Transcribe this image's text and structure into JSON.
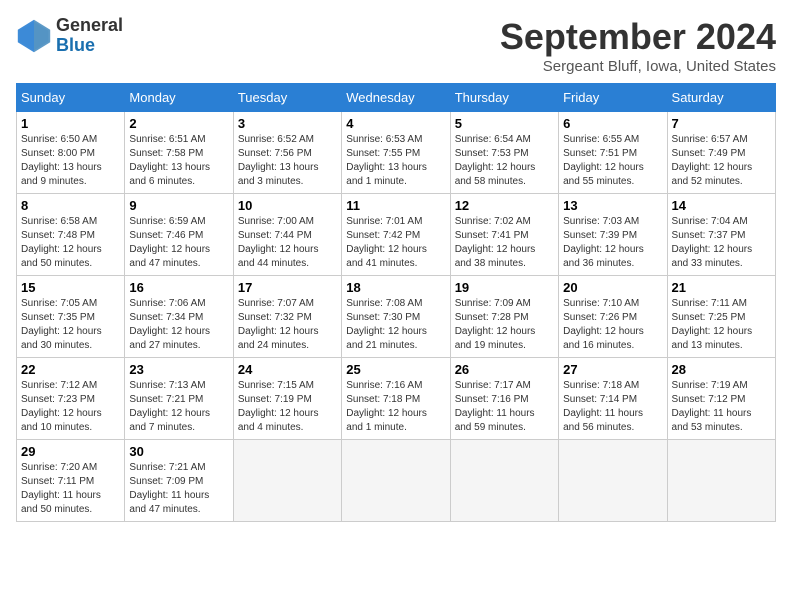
{
  "header": {
    "logo_line1": "General",
    "logo_line2": "Blue",
    "month_title": "September 2024",
    "location": "Sergeant Bluff, Iowa, United States"
  },
  "weekdays": [
    "Sunday",
    "Monday",
    "Tuesday",
    "Wednesday",
    "Thursday",
    "Friday",
    "Saturday"
  ],
  "weeks": [
    [
      {
        "day": "1",
        "detail": "Sunrise: 6:50 AM\nSunset: 8:00 PM\nDaylight: 13 hours\nand 9 minutes."
      },
      {
        "day": "2",
        "detail": "Sunrise: 6:51 AM\nSunset: 7:58 PM\nDaylight: 13 hours\nand 6 minutes."
      },
      {
        "day": "3",
        "detail": "Sunrise: 6:52 AM\nSunset: 7:56 PM\nDaylight: 13 hours\nand 3 minutes."
      },
      {
        "day": "4",
        "detail": "Sunrise: 6:53 AM\nSunset: 7:55 PM\nDaylight: 13 hours\nand 1 minute."
      },
      {
        "day": "5",
        "detail": "Sunrise: 6:54 AM\nSunset: 7:53 PM\nDaylight: 12 hours\nand 58 minutes."
      },
      {
        "day": "6",
        "detail": "Sunrise: 6:55 AM\nSunset: 7:51 PM\nDaylight: 12 hours\nand 55 minutes."
      },
      {
        "day": "7",
        "detail": "Sunrise: 6:57 AM\nSunset: 7:49 PM\nDaylight: 12 hours\nand 52 minutes."
      }
    ],
    [
      {
        "day": "8",
        "detail": "Sunrise: 6:58 AM\nSunset: 7:48 PM\nDaylight: 12 hours\nand 50 minutes."
      },
      {
        "day": "9",
        "detail": "Sunrise: 6:59 AM\nSunset: 7:46 PM\nDaylight: 12 hours\nand 47 minutes."
      },
      {
        "day": "10",
        "detail": "Sunrise: 7:00 AM\nSunset: 7:44 PM\nDaylight: 12 hours\nand 44 minutes."
      },
      {
        "day": "11",
        "detail": "Sunrise: 7:01 AM\nSunset: 7:42 PM\nDaylight: 12 hours\nand 41 minutes."
      },
      {
        "day": "12",
        "detail": "Sunrise: 7:02 AM\nSunset: 7:41 PM\nDaylight: 12 hours\nand 38 minutes."
      },
      {
        "day": "13",
        "detail": "Sunrise: 7:03 AM\nSunset: 7:39 PM\nDaylight: 12 hours\nand 36 minutes."
      },
      {
        "day": "14",
        "detail": "Sunrise: 7:04 AM\nSunset: 7:37 PM\nDaylight: 12 hours\nand 33 minutes."
      }
    ],
    [
      {
        "day": "15",
        "detail": "Sunrise: 7:05 AM\nSunset: 7:35 PM\nDaylight: 12 hours\nand 30 minutes."
      },
      {
        "day": "16",
        "detail": "Sunrise: 7:06 AM\nSunset: 7:34 PM\nDaylight: 12 hours\nand 27 minutes."
      },
      {
        "day": "17",
        "detail": "Sunrise: 7:07 AM\nSunset: 7:32 PM\nDaylight: 12 hours\nand 24 minutes."
      },
      {
        "day": "18",
        "detail": "Sunrise: 7:08 AM\nSunset: 7:30 PM\nDaylight: 12 hours\nand 21 minutes."
      },
      {
        "day": "19",
        "detail": "Sunrise: 7:09 AM\nSunset: 7:28 PM\nDaylight: 12 hours\nand 19 minutes."
      },
      {
        "day": "20",
        "detail": "Sunrise: 7:10 AM\nSunset: 7:26 PM\nDaylight: 12 hours\nand 16 minutes."
      },
      {
        "day": "21",
        "detail": "Sunrise: 7:11 AM\nSunset: 7:25 PM\nDaylight: 12 hours\nand 13 minutes."
      }
    ],
    [
      {
        "day": "22",
        "detail": "Sunrise: 7:12 AM\nSunset: 7:23 PM\nDaylight: 12 hours\nand 10 minutes."
      },
      {
        "day": "23",
        "detail": "Sunrise: 7:13 AM\nSunset: 7:21 PM\nDaylight: 12 hours\nand 7 minutes."
      },
      {
        "day": "24",
        "detail": "Sunrise: 7:15 AM\nSunset: 7:19 PM\nDaylight: 12 hours\nand 4 minutes."
      },
      {
        "day": "25",
        "detail": "Sunrise: 7:16 AM\nSunset: 7:18 PM\nDaylight: 12 hours\nand 1 minute."
      },
      {
        "day": "26",
        "detail": "Sunrise: 7:17 AM\nSunset: 7:16 PM\nDaylight: 11 hours\nand 59 minutes."
      },
      {
        "day": "27",
        "detail": "Sunrise: 7:18 AM\nSunset: 7:14 PM\nDaylight: 11 hours\nand 56 minutes."
      },
      {
        "day": "28",
        "detail": "Sunrise: 7:19 AM\nSunset: 7:12 PM\nDaylight: 11 hours\nand 53 minutes."
      }
    ],
    [
      {
        "day": "29",
        "detail": "Sunrise: 7:20 AM\nSunset: 7:11 PM\nDaylight: 11 hours\nand 50 minutes."
      },
      {
        "day": "30",
        "detail": "Sunrise: 7:21 AM\nSunset: 7:09 PM\nDaylight: 11 hours\nand 47 minutes."
      },
      null,
      null,
      null,
      null,
      null
    ]
  ]
}
